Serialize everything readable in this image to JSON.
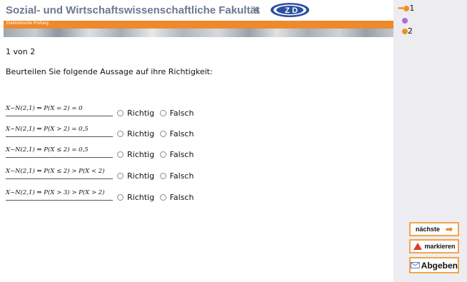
{
  "header": {
    "title": "Sozial- und Wirtschaftswissenschaftliche Fakultät",
    "amp": "&",
    "logo_text": "ZID",
    "subtitle": "Elektronische Prüfung"
  },
  "main": {
    "counter": "1 von 2",
    "question": "Beurteilen Sie folgende Aussage auf ihre Richtigkeit:",
    "option_true": "Richtig",
    "option_false": "Falsch",
    "statements": [
      "X~N(2,1) ⇒ P(X = 2) = 0",
      "X~N(2,1) ⇒ P(X > 2) = 0,5",
      "X~N(2,1) ⇒ P(X ≤ 2) = 0,5",
      "X~N(2,1) ⇒ P(X ≤ 2) > P(X < 2)",
      "X~N(2,1) ⇒ P(X > 3) > P(X > 2)"
    ]
  },
  "sidebar": {
    "nav": [
      {
        "label": "1",
        "current": true,
        "color": "#f09020"
      },
      {
        "label": "",
        "current": false,
        "color": "#b36ad0"
      },
      {
        "label": "2",
        "current": false,
        "color": "#f09020"
      }
    ],
    "next_label": "nächste",
    "mark_label": "markieren",
    "submit_label": "Abgeben"
  },
  "colors": {
    "accent": "#ee8a2b",
    "title": "#6d7893",
    "sidebar_bg": "#ededf1"
  }
}
